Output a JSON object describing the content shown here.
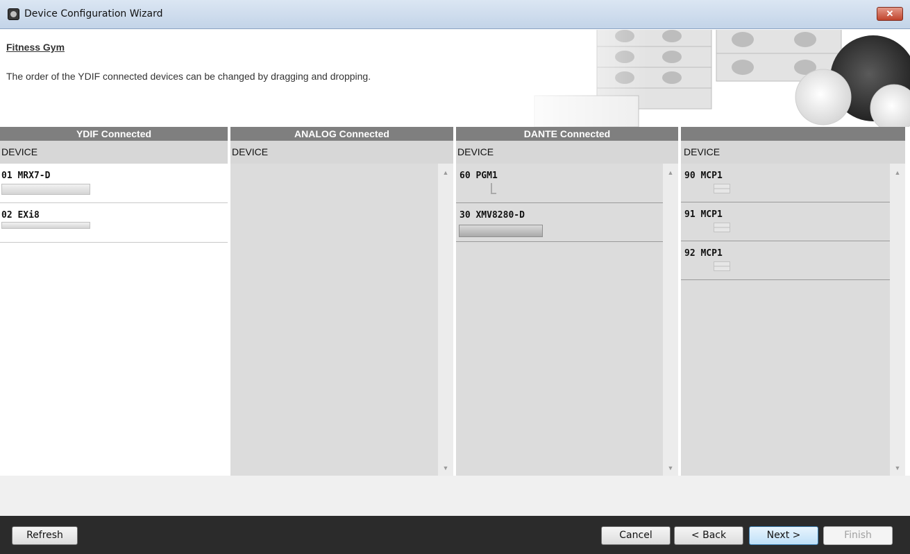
{
  "window": {
    "title": "Device Configuration Wizard",
    "close_icon": "close-x-icon"
  },
  "header": {
    "project_name": "Fitness Gym",
    "instructions": "The order of the YDIF connected devices can be changed by dragging and dropping."
  },
  "columns": [
    {
      "title": "YDIF Connected",
      "device_label": "DEVICE",
      "devices": [
        {
          "name": "01 MRX7-D"
        },
        {
          "name": "02 EXi8"
        }
      ]
    },
    {
      "title": "ANALOG Connected",
      "device_label": "DEVICE",
      "devices": []
    },
    {
      "title": "DANTE Connected",
      "device_label": "DEVICE",
      "devices": [
        {
          "name": "60 PGM1"
        },
        {
          "name": "30 XMV8280-D"
        }
      ]
    },
    {
      "title": "",
      "device_label": "DEVICE",
      "devices": [
        {
          "name": "90 MCP1"
        },
        {
          "name": "91 MCP1"
        },
        {
          "name": "92 MCP1"
        }
      ]
    }
  ],
  "footer": {
    "refresh": "Refresh",
    "cancel": "Cancel",
    "back": "< Back",
    "next": "Next >",
    "finish": "Finish"
  },
  "colors": {
    "column_header": "#7f7f7f",
    "device_label_bar": "#d7d7d7",
    "list_background": "#dcdcdc",
    "footer_bar": "#2b2b2b"
  }
}
